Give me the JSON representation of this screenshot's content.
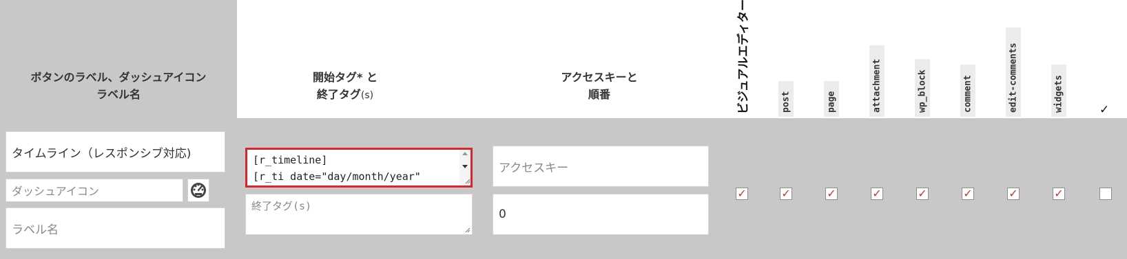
{
  "header": {
    "col1_line1": "ボタンのラベル、ダッシュアイコン",
    "col1_line2": "ラベル名",
    "col2_line1_main": "開始タグ",
    "col2_line1_rest": "* と",
    "col2_line2_main": "終了タグ",
    "col2_line2_rest": "(s)",
    "col3_line1": "アクセスキーと",
    "col3_line2": "順番",
    "visual_editor": "ビジュアルエディター",
    "post_types": [
      "post",
      "page",
      "attachment",
      "wp_block",
      "comment",
      "edit-comments",
      "widgets"
    ],
    "check_all": "✓"
  },
  "row": {
    "button_label_value": "タイムライン（レスポンシブ対応)",
    "dashicon_placeholder": "ダッシュアイコン",
    "label_name_placeholder": "ラベル名",
    "start_tag_line1": "[r_timeline]",
    "start_tag_line2": "[r_ti date=\"day/month/year\"",
    "end_tag_placeholder": "終了タグ(s)",
    "access_key_placeholder": "アクセスキー",
    "order_value": "0",
    "checkboxes": [
      true,
      true,
      true,
      true,
      true,
      true,
      true,
      true,
      false
    ],
    "check_glyph": "✓"
  },
  "colors": {
    "highlight_border": "#d9262d",
    "check_color": "#c0392b",
    "header_bg": "#c8c8c8"
  }
}
